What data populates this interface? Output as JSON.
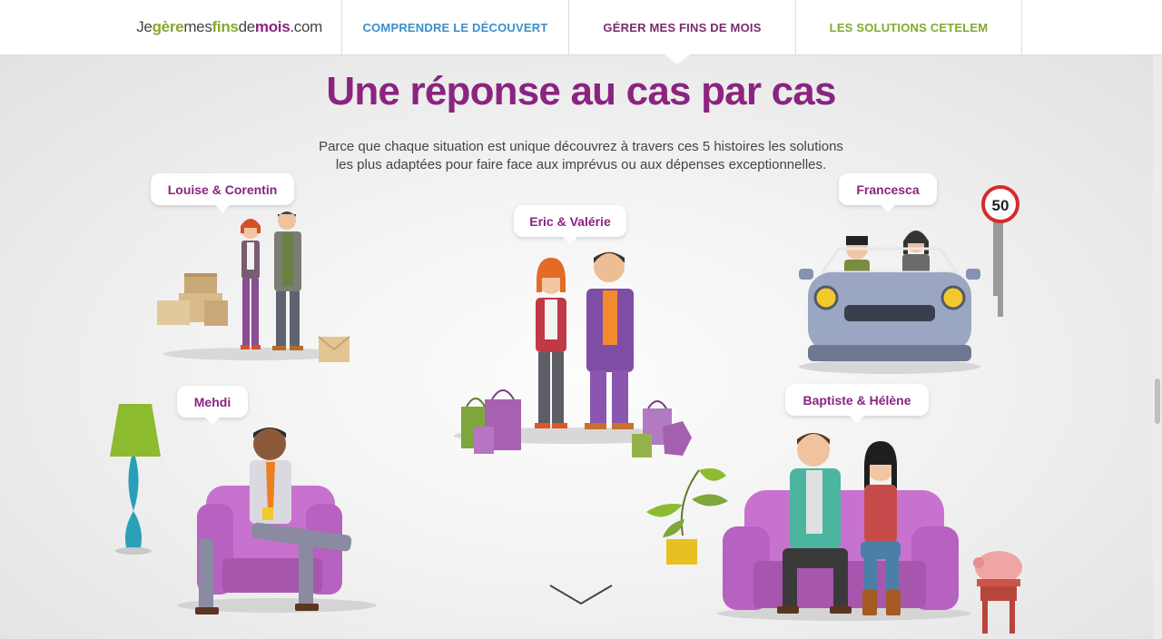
{
  "nav": {
    "logo_parts": [
      "Je",
      "gère",
      "mes",
      "fins",
      "de",
      "mois",
      ".com"
    ],
    "items": [
      {
        "label": "COMPRENDRE LE DÉCOUVERT"
      },
      {
        "label": "GÉRER MES FINS DE MOIS"
      },
      {
        "label": "LES SOLUTIONS CETELEM"
      }
    ]
  },
  "main": {
    "title": "Une réponse au cas par cas",
    "subtitle_line1": "Parce que chaque situation est unique découvrez à travers ces 5 histoires les solutions",
    "subtitle_line2": "les plus adaptées pour faire face aux imprévus ou aux dépenses exceptionnelles."
  },
  "stories": [
    {
      "label": "Louise & Corentin"
    },
    {
      "label": "Eric & Valérie"
    },
    {
      "label": "Francesca"
    },
    {
      "label": "Mehdi"
    },
    {
      "label": "Baptiste & Hélène"
    }
  ],
  "sign": {
    "speed": "50"
  },
  "icons": {
    "scroll_down": "chevron-down-icon"
  },
  "colors": {
    "brand_purple": "#8a2480",
    "green": "#86a82b",
    "blue": "#3a8fc9"
  }
}
